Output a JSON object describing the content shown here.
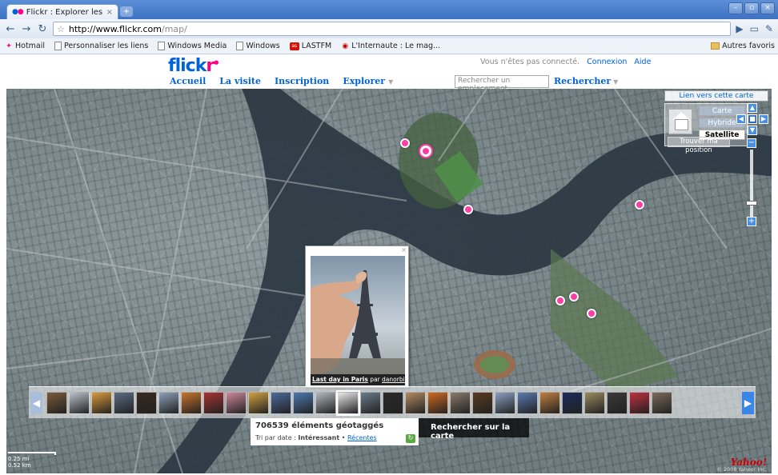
{
  "browser": {
    "tab_title": "Flickr : Explorer les photos ...",
    "tab_close": "×",
    "new_tab": "+",
    "window_buttons": [
      "–",
      "▫",
      "×"
    ],
    "url_host": "http://www.flickr.com",
    "url_path": "/map/",
    "bookmarks": [
      {
        "label": "Hotmail",
        "icon": "hotmail-icon"
      },
      {
        "label": "Personnaliser les liens",
        "icon": "page-icon"
      },
      {
        "label": "Windows Media",
        "icon": "page-icon"
      },
      {
        "label": "Windows",
        "icon": "page-icon"
      },
      {
        "label": "LASTFM",
        "icon": "lastfm-icon"
      },
      {
        "label": "L'Internaute : Le mag...",
        "icon": "internaute-icon"
      }
    ],
    "other_bookmarks": "Autres favoris"
  },
  "header": {
    "logo_main": "flick",
    "logo_accent": "r",
    "nav": [
      "Accueil",
      "La visite",
      "Inscription",
      "Explorer"
    ],
    "not_connected": "Vous n'êtes pas connecté.",
    "login": "Connexion",
    "help": "Aide",
    "search_placeholder": "Rechercher un emplacement",
    "search_button": "Rechercher"
  },
  "map": {
    "link_map": "Lien vers cette carte",
    "map_types": [
      "Carte",
      "Hybride",
      "Satellite"
    ],
    "active_map_type": "Satellite",
    "find_position": "Trouver ma position",
    "popup": {
      "photo_title": "Last day in Paris",
      "by": "par",
      "author": "danorbit."
    },
    "geotagged_count": "706539 éléments géotaggés",
    "sort_prefix": "Tri par date :",
    "sort_active": "Intéressant",
    "sort_separator": "•",
    "sort_other": "Récentes",
    "search_on_map": "Rechercher sur la carte",
    "scale_top": "0.25 mi",
    "scale_bottom": "0.52 km",
    "yahoo_logo": "Yahoo!",
    "copyright": "© 2008 Yahoo! Inc."
  },
  "colors": {
    "flickr_blue": "#0063dc",
    "flickr_pink": "#ff0084",
    "pin": "#ff3ea5"
  }
}
